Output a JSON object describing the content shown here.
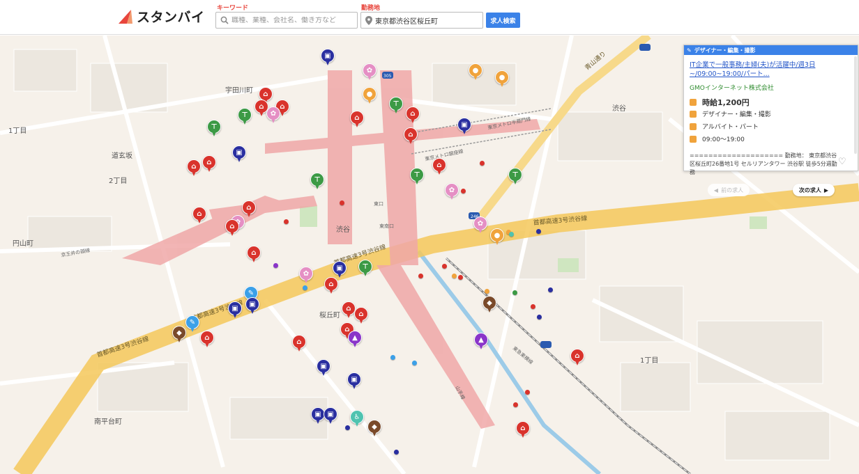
{
  "header": {
    "logo_text": "スタンバイ",
    "keyword_label": "キーワード",
    "keyword_placeholder": "職種、業種、会社名、働き方など",
    "location_label": "勤務地",
    "location_value": "東京都渋谷区桜丘町",
    "search_button": "求人検索"
  },
  "job_card": {
    "category": "デザイナー・編集・撮影",
    "title": "IT企業で一般事務/主婦(夫)が活躍中/週3日~/09:00~19:00/パート...",
    "company": "GMOインターネット株式会社",
    "wage": "時給1,200円",
    "job_type": "デザイナー・編集・撮影",
    "employment": "アルバイト・パート",
    "hours": "09:00〜19:00",
    "description": "==================== 勤務地： 東京都渋谷区桜丘町26番地1号 セルリアンタワー 渋谷駅 徒歩5分週勤務"
  },
  "navigation": {
    "prev": "前の求人",
    "next": "次の求人"
  },
  "map_labels": {
    "udagawa": "宇田川町",
    "dogenzaka": "道玄坂",
    "dogenzaka2": "2丁目",
    "shibuya": "渋谷",
    "sakuragaoka": "桜丘町",
    "nanpeidai": "南平台町",
    "maruyama": "円山町",
    "icchome": "1丁目",
    "icchome2": "1丁目",
    "aoyama_dori": "青山通り",
    "expressway_a": "首都高速3号渋谷線",
    "expressway_b": "首都高速3号渋谷線",
    "expressway_c": "首都高速3号渋谷線",
    "expressway_d": "首都高速3号渋谷線",
    "toyoko_line": "東急東横線",
    "metro_hanzomon": "東京メトロ半蔵門線",
    "metro_ginza": "東京メトロ銀座線",
    "inokashira": "京王井の頭線",
    "shibuya_station": "渋谷",
    "higashiguchi": "東口",
    "minamiguchi": "東南口",
    "yamanote": "山手線",
    "route_246": "246",
    "route_305": "305"
  },
  "colors": {
    "brand_red": "#e8453c",
    "primary_blue": "#3b82e8",
    "company_green": "#2f8c2f",
    "pin_red": "#d9332c",
    "pin_navy": "#2a2fa0",
    "pin_green": "#3c9a45",
    "pin_pink": "#e58fc4",
    "pin_orange": "#f0a33c",
    "pin_brown": "#7a4a2a",
    "pin_purple": "#8a35c9",
    "pin_lightblue": "#3ba0e8",
    "pin_teal": "#4fc3b0"
  },
  "pins": [
    {
      "color": "#d9332c",
      "icon": "bag-icon",
      "glyph": "⌂"
    },
    {
      "color": "#2a2fa0",
      "icon": "briefcase-icon",
      "glyph": "▣"
    },
    {
      "color": "#3c9a45",
      "icon": "shirt-icon",
      "glyph": "⊤"
    },
    {
      "color": "#e58fc4",
      "icon": "flower-icon",
      "glyph": "✿"
    },
    {
      "color": "#f0a33c",
      "icon": "people-icon",
      "glyph": "●"
    },
    {
      "color": "#7a4a2a",
      "icon": "tag-icon",
      "glyph": "◆"
    },
    {
      "color": "#8a35c9",
      "icon": "graduation-icon",
      "glyph": "▲"
    },
    {
      "color": "#3ba0e8",
      "icon": "pencil-icon",
      "glyph": "✎"
    },
    {
      "color": "#4fc3b0",
      "icon": "wheelchair-icon",
      "glyph": "♿"
    }
  ]
}
